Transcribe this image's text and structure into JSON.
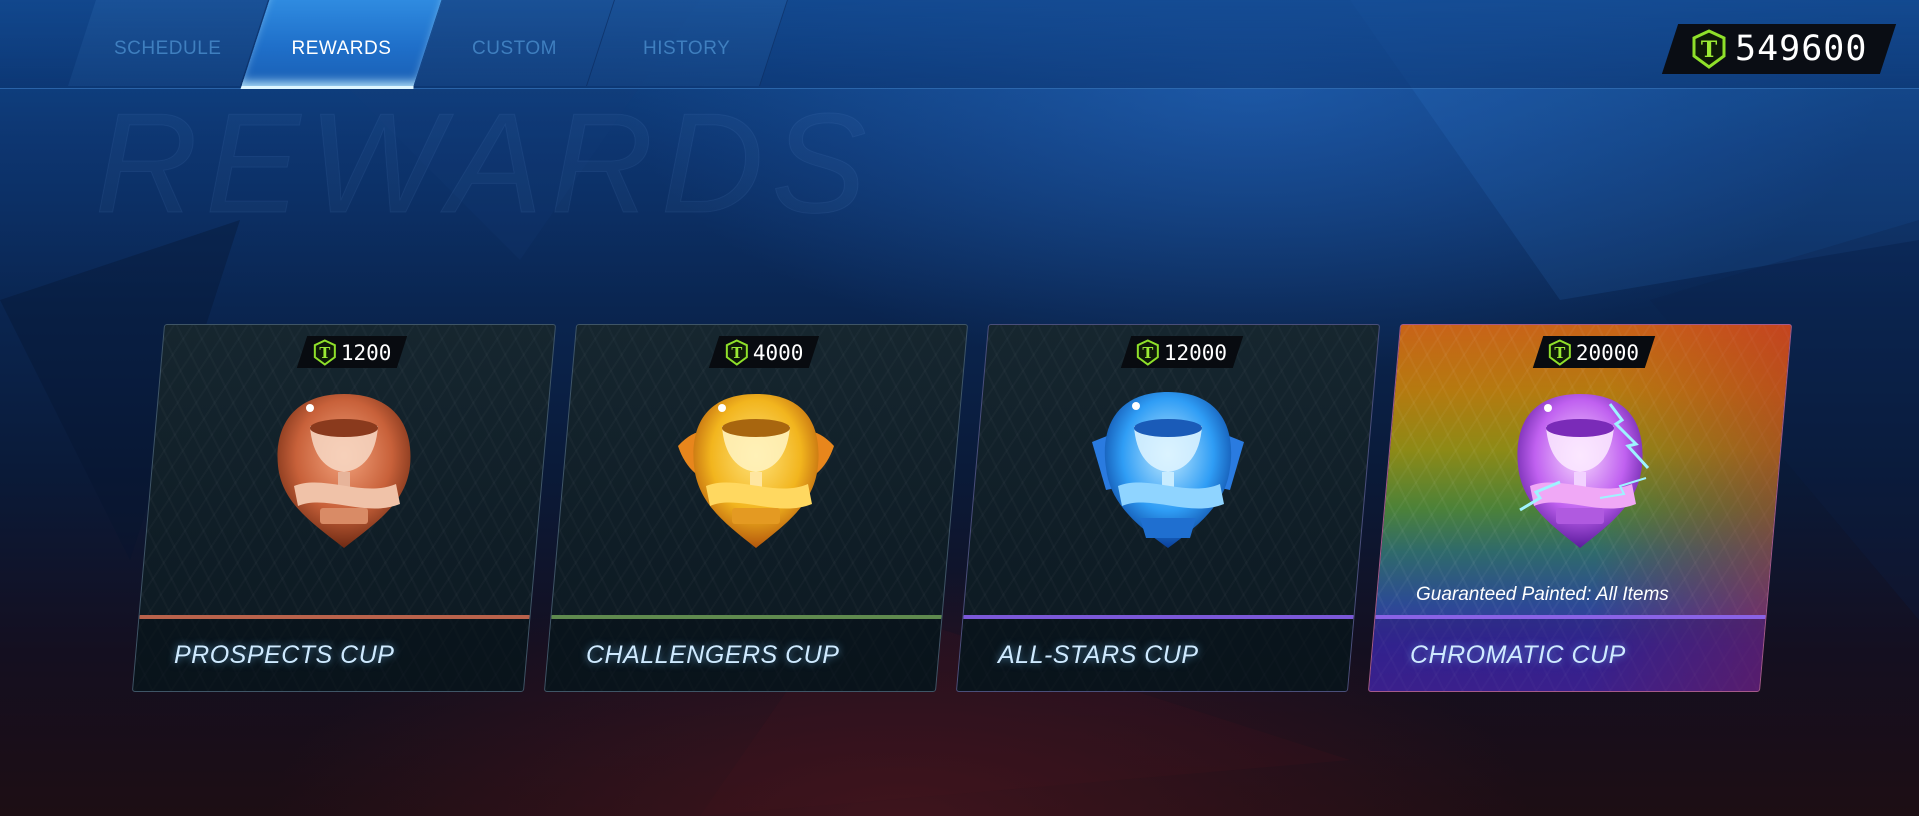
{
  "nav": {
    "tabs": [
      {
        "label": "SCHEDULE",
        "active": false
      },
      {
        "label": "REWARDS",
        "active": true
      },
      {
        "label": "CUSTOM",
        "active": false
      },
      {
        "label": "HISTORY",
        "active": false
      }
    ]
  },
  "credits": {
    "icon": "tournament-credits-icon",
    "value": "549600"
  },
  "page": {
    "watermark": "REWARDS"
  },
  "rewards": [
    {
      "name": "PROSPECTS CUP",
      "cost": "1200",
      "trophy": "bronze-trophy-icon",
      "accent": "#b9624b",
      "note": ""
    },
    {
      "name": "CHALLENGERS CUP",
      "cost": "4000",
      "trophy": "gold-trophy-icon",
      "accent": "#5f8a4e",
      "note": ""
    },
    {
      "name": "ALL-STARS CUP",
      "cost": "12000",
      "trophy": "blue-trophy-icon",
      "accent": "#7b58d8",
      "note": ""
    },
    {
      "name": "CHROMATIC CUP",
      "cost": "20000",
      "trophy": "chromatic-trophy-icon",
      "accent": "#8a62e6",
      "note": "Guaranteed Painted: All Items"
    }
  ],
  "colors": {
    "credit_icon": "#7ed321",
    "bronze": "#c8613a",
    "gold": "#f2b51e",
    "blue": "#2f9df5",
    "chromatic": "#c061f0"
  }
}
